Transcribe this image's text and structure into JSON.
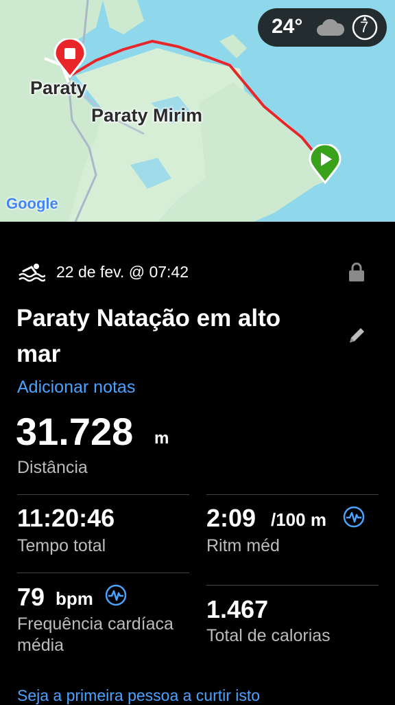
{
  "map": {
    "weather_temp": "24°",
    "weather_icon": "cloud-icon",
    "compass_value": "7",
    "labels": {
      "paraty": "Paraty",
      "paraty_mirim": "Paraty Mirim"
    },
    "attribution": "Google",
    "route_color": "#e8262a",
    "start_marker_color": "#3aa11b",
    "end_marker_color": "#e8262a"
  },
  "activity": {
    "sport_icon": "swim-icon",
    "date": "22 de fev. @ 07:42",
    "title": "Paraty Natação em alto mar",
    "add_notes": "Adicionar notas",
    "distance": {
      "value": "31.728",
      "unit": "m",
      "label": "Distância"
    },
    "stats": {
      "total_time": {
        "value": "11:20:46",
        "label": "Tempo total"
      },
      "avg_pace": {
        "value": "2:09",
        "unit": "/100 m",
        "label": "Ritm méd"
      },
      "heart_rate": {
        "value": "79",
        "unit": "bpm",
        "label": "Frequência cardíaca média"
      },
      "calories": {
        "value": "1.467",
        "label": "Total de calorias"
      }
    },
    "like_prompt": "Seja a primeira pessoa a curtir isto"
  },
  "colors": {
    "link": "#4aa3ff",
    "background": "#000000",
    "water": "#8fd8ec",
    "land": "#cde9cf"
  }
}
